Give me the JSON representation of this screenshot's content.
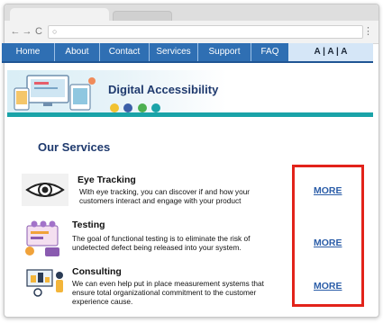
{
  "browser": {
    "address": "",
    "back_glyph": "←",
    "forward_glyph": "→",
    "reload_glyph": "C",
    "search_glyph": "○",
    "menu_glyph": "⋮"
  },
  "nav": {
    "items": [
      "Home",
      "About",
      "Contact",
      "Services",
      "Support",
      "FAQ"
    ],
    "font_size_controls": "A | A | A"
  },
  "banner": {
    "title": "Digital Accessibility",
    "accessibility_icons": [
      "eye-icon",
      "ear-icon",
      "hand-icon",
      "brain-icon"
    ]
  },
  "page": {
    "section_title": "Our Services"
  },
  "services": [
    {
      "title": "Eye Tracking",
      "description": "With eye tracking, you can discover if and how your customers interact and engage with your product",
      "more_label": "MORE",
      "icon": "eye-icon"
    },
    {
      "title": "Testing",
      "description": "The goal of functional testing is to eliminate the risk of undetected defect being released into your system.",
      "more_label": "MORE",
      "icon": "testing-illustration-icon"
    },
    {
      "title": "Consulting",
      "description": "We can even help put in place measurement systems that ensure total organizational commitment to the customer experience cause.",
      "more_label": "MORE",
      "icon": "consulting-illustration-icon"
    }
  ],
  "colors": {
    "nav_bg": "#2f6fb3",
    "heading": "#1f3a6e",
    "link": "#2b5da8",
    "highlight": "#e2231a",
    "teal": "#1aa3a8"
  }
}
